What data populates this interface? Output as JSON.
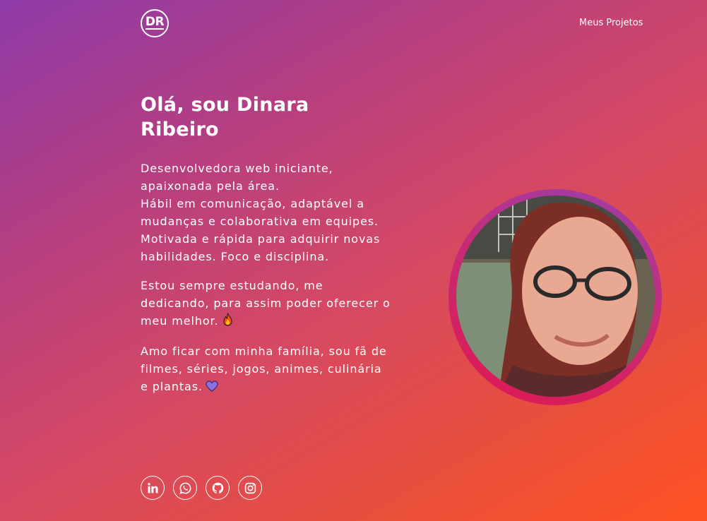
{
  "header": {
    "logo_text": "DR",
    "nav_link": "Meus Projetos"
  },
  "hero": {
    "title": "Olá, sou Dinara Ribeiro",
    "paragraphs": [
      {
        "lines": [
          "Desenvolvedora web iniciante, apaixonada pela área.",
          "Hábil em comunicação, adaptável a mudanças e colaborativa em equipes.",
          "Motivada e rápida para adquirir novas habilidades. Foco e disciplina."
        ]
      },
      {
        "text": "Estou sempre estudando, me dedicando, para assim poder oferecer o meu melhor.",
        "emoji": "fire-emoji"
      },
      {
        "text": "Amo ficar com minha família, sou fã de filmes, séries, jogos, animes, culinária e plantas.",
        "emoji": "purple-heart-emoji"
      }
    ]
  },
  "socials": [
    {
      "icon": "linkedin-icon"
    },
    {
      "icon": "whatsapp-icon"
    },
    {
      "icon": "github-icon"
    },
    {
      "icon": "instagram-icon"
    }
  ],
  "avatar": {
    "icon": "profile-photo"
  },
  "colors": {
    "gradient_start": "#8e3aa8",
    "gradient_end": "#ff5222",
    "ring": "#c72b75",
    "text": "#ffffff"
  }
}
